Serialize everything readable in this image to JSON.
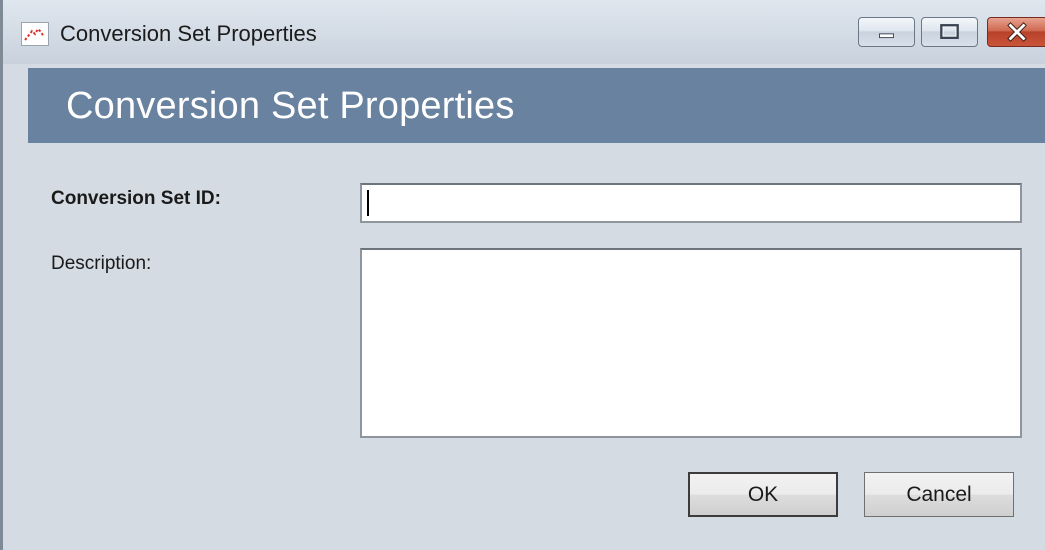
{
  "window": {
    "title": "Conversion Set Properties",
    "icon": "conversion-set-app-icon",
    "controls": {
      "minimize_icon": "minimize-icon",
      "maximize_icon": "maximize-icon",
      "close_icon": "close-icon"
    }
  },
  "header": {
    "title": "Conversion Set Properties",
    "background_color": "#68829f"
  },
  "form": {
    "id_label": "Conversion Set ID:",
    "id_value": "",
    "description_label": "Description:",
    "description_value": ""
  },
  "buttons": {
    "ok_label": "OK",
    "cancel_label": "Cancel"
  }
}
